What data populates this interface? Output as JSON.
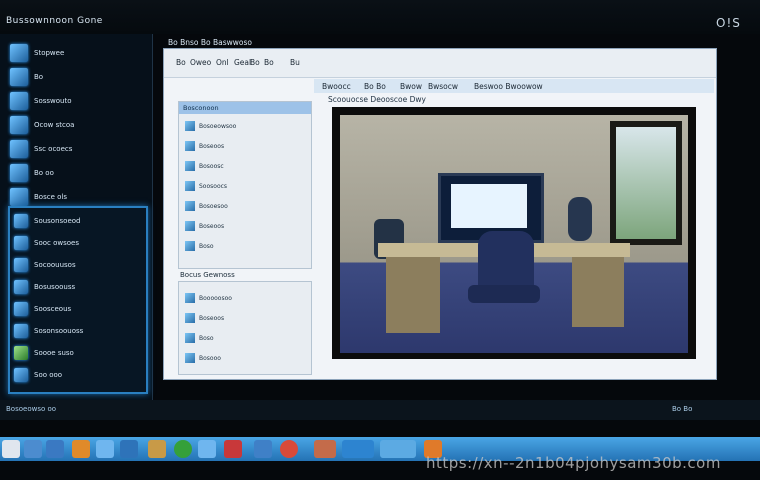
{
  "topbar": {
    "title": "Bussownnoon Gone",
    "clock": "O!S"
  },
  "left_panel": {
    "items": [
      {
        "label": "Stopwee",
        "icon": "app-icon"
      },
      {
        "label": "Bo",
        "icon": "app-icon"
      },
      {
        "label": "Sosswouto",
        "icon": "app-icon"
      },
      {
        "label": "Ocow stcoa",
        "icon": "app-icon"
      },
      {
        "label": "Ssc ocoecs",
        "icon": "app-icon"
      },
      {
        "label": "Bo oo",
        "icon": "app-icon"
      },
      {
        "label": "Bosce ols",
        "icon": "app-icon"
      }
    ],
    "sub_items": [
      {
        "label": "Sousonsoeod"
      },
      {
        "label": "Sooc owsoes"
      },
      {
        "label": "Socoouusos"
      },
      {
        "label": "Bosusoouss"
      },
      {
        "label": "Soosceous"
      },
      {
        "label": "Sosonsoouoss"
      },
      {
        "label": "Soooe suso"
      },
      {
        "label": "Soo ooo"
      }
    ]
  },
  "main_window": {
    "title_bar": "Bo Bnso Bo Baswwoso",
    "menu": [
      "Bo",
      "Oweo",
      "Onl",
      "Geal",
      "Bo",
      "Bo",
      "Bu"
    ],
    "side_header": "Bosconoon",
    "side_rows": [
      "Bosoeowsoo",
      "Boseoos",
      "Bosoosc",
      "Soosoocs",
      "Bosoesoo",
      "Boseoos",
      "Boso"
    ],
    "side2_title": "Bocus Gewnoss",
    "side2_rows": [
      "Booooosoo",
      "Boseoos",
      "Boso",
      "Bosooo"
    ],
    "content_tabs": [
      "Bwoocc",
      "Bo Bo",
      "Bwow",
      "Bwsocw",
      "Beswoo Bwoowow"
    ],
    "content_path": "Scoouocse Deooscoe Dwy"
  },
  "status": {
    "left": "Bosoeowso oo",
    "right": "Bo Bo"
  },
  "watermark": "https://xn--2n1b04pjohysam30b.com",
  "colors": {
    "accent": "#2a9bff",
    "taskbar": "#3d96d8",
    "background": "#05080c"
  }
}
